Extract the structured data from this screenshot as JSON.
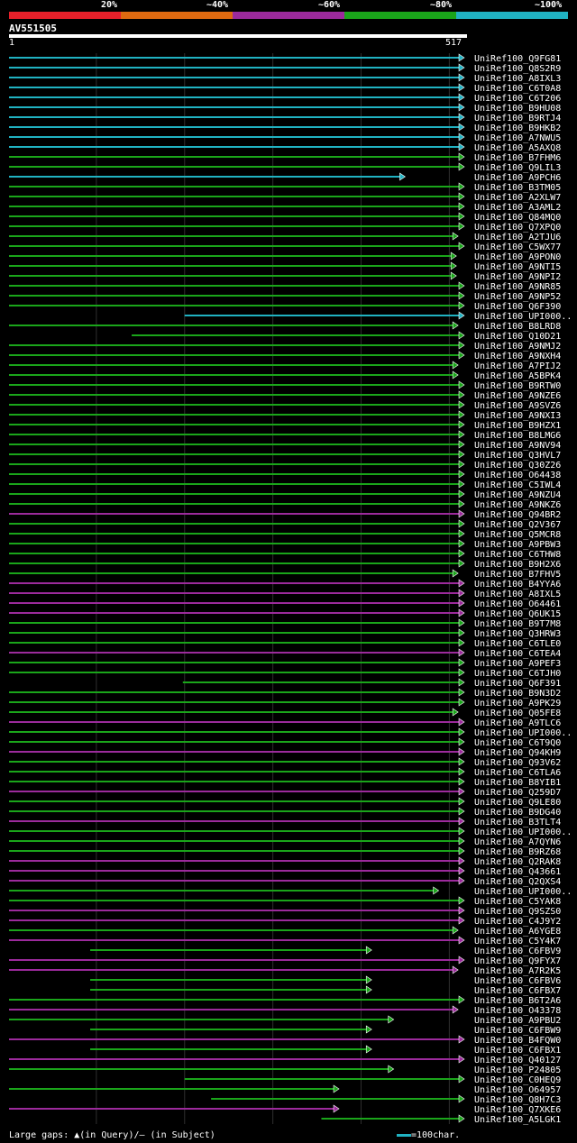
{
  "legend": {
    "labels": [
      "20%",
      "~40%",
      "~60%",
      "~80%",
      "~100%"
    ],
    "colors": [
      "#e8202a",
      "#e06a10",
      "#9c2a9c",
      "#1aa51a",
      "#20b2c2"
    ]
  },
  "query": {
    "name": "AV551505",
    "start": "1",
    "end": "517",
    "length": 517
  },
  "footer": {
    "text": "Large gaps: ▲(in Query)/– (in Subject)",
    "scale": "=100char."
  },
  "hits": [
    {
      "label": "UniRef100_Q9FG81",
      "s": 1,
      "e": 517,
      "c": 4
    },
    {
      "label": "UniRef100_Q8S2R9",
      "s": 1,
      "e": 517,
      "c": 4
    },
    {
      "label": "UniRef100_A8IXL3",
      "s": 1,
      "e": 517,
      "c": 4
    },
    {
      "label": "UniRef100_C6T0A8",
      "s": 1,
      "e": 517,
      "c": 4
    },
    {
      "label": "UniRef100_C6T206",
      "s": 1,
      "e": 517,
      "c": 4
    },
    {
      "label": "UniRef100_B9HU08",
      "s": 1,
      "e": 517,
      "c": 4
    },
    {
      "label": "UniRef100_B9RTJ4",
      "s": 1,
      "e": 517,
      "c": 4
    },
    {
      "label": "UniRef100_B9HKB2",
      "s": 1,
      "e": 517,
      "c": 4
    },
    {
      "label": "UniRef100_A7NWU5",
      "s": 1,
      "e": 517,
      "c": 4
    },
    {
      "label": "UniRef100_A5AXQ8",
      "s": 1,
      "e": 517,
      "c": 4
    },
    {
      "label": "UniRef100_B7FHM6",
      "s": 1,
      "e": 517,
      "c": 3
    },
    {
      "label": "UniRef100_Q9LIL3",
      "s": 1,
      "e": 517,
      "c": 3
    },
    {
      "label": "UniRef100_A9PCH6",
      "s": 1,
      "e": 450,
      "c": 4
    },
    {
      "label": "UniRef100_B3TM05",
      "s": 1,
      "e": 517,
      "c": 3
    },
    {
      "label": "UniRef100_A2XLW7",
      "s": 1,
      "e": 517,
      "c": 3
    },
    {
      "label": "UniRef100_A3AML2",
      "s": 1,
      "e": 517,
      "c": 3
    },
    {
      "label": "UniRef100_Q84MQ0",
      "s": 1,
      "e": 517,
      "c": 3
    },
    {
      "label": "UniRef100_Q7XPQ0",
      "s": 1,
      "e": 517,
      "c": 3
    },
    {
      "label": "UniRef100_A2TJU6",
      "s": 1,
      "e": 510,
      "c": 3
    },
    {
      "label": "UniRef100_C5WX77",
      "s": 1,
      "e": 517,
      "c": 3
    },
    {
      "label": "UniRef100_A9PON0",
      "s": 1,
      "e": 508,
      "c": 3
    },
    {
      "label": "UniRef100_A9NTI5",
      "s": 1,
      "e": 508,
      "c": 3
    },
    {
      "label": "UniRef100_A9NPI2",
      "s": 1,
      "e": 508,
      "c": 3
    },
    {
      "label": "UniRef100_A9NR85",
      "s": 1,
      "e": 517,
      "c": 3
    },
    {
      "label": "UniRef100_A9NP52",
      "s": 1,
      "e": 517,
      "c": 3
    },
    {
      "label": "UniRef100_Q6F390",
      "s": 1,
      "e": 517,
      "c": 3
    },
    {
      "label": "UniRef100_UPI000..",
      "s": 200,
      "e": 517,
      "c": 4
    },
    {
      "label": "UniRef100_B8LRD8",
      "s": 1,
      "e": 510,
      "c": 3
    },
    {
      "label": "UniRef100_Q10D21",
      "s": 140,
      "e": 517,
      "c": 3
    },
    {
      "label": "UniRef100_A9NMJ2",
      "s": 1,
      "e": 517,
      "c": 3
    },
    {
      "label": "UniRef100_A9NXH4",
      "s": 1,
      "e": 517,
      "c": 3
    },
    {
      "label": "UniRef100_A7PIJ2",
      "s": 1,
      "e": 510,
      "c": 3
    },
    {
      "label": "UniRef100_A5BPK4",
      "s": 1,
      "e": 510,
      "c": 3
    },
    {
      "label": "UniRef100_B9RTW0",
      "s": 1,
      "e": 517,
      "c": 3
    },
    {
      "label": "UniRef100_A9NZE6",
      "s": 1,
      "e": 517,
      "c": 3
    },
    {
      "label": "UniRef100_A9SVZ6",
      "s": 1,
      "e": 517,
      "c": 3
    },
    {
      "label": "UniRef100_A9NXI3",
      "s": 1,
      "e": 517,
      "c": 3
    },
    {
      "label": "UniRef100_B9HZX1",
      "s": 1,
      "e": 517,
      "c": 3
    },
    {
      "label": "UniRef100_B8LMG6",
      "s": 1,
      "e": 517,
      "c": 3
    },
    {
      "label": "UniRef100_A9NV94",
      "s": 1,
      "e": 517,
      "c": 3
    },
    {
      "label": "UniRef100_Q3HVL7",
      "s": 1,
      "e": 517,
      "c": 3
    },
    {
      "label": "UniRef100_Q30Z26",
      "s": 1,
      "e": 517,
      "c": 3
    },
    {
      "label": "UniRef100_O64438",
      "s": 1,
      "e": 517,
      "c": 3
    },
    {
      "label": "UniRef100_C5IWL4",
      "s": 1,
      "e": 517,
      "c": 3
    },
    {
      "label": "UniRef100_A9NZU4",
      "s": 1,
      "e": 517,
      "c": 3
    },
    {
      "label": "UniRef100_A9NKZ6",
      "s": 1,
      "e": 517,
      "c": 3
    },
    {
      "label": "UniRef100_Q94BR2",
      "s": 1,
      "e": 517,
      "c": 2
    },
    {
      "label": "UniRef100_Q2V367",
      "s": 1,
      "e": 517,
      "c": 3
    },
    {
      "label": "UniRef100_Q5MCR8",
      "s": 1,
      "e": 517,
      "c": 3
    },
    {
      "label": "UniRef100_A9PBW3",
      "s": 1,
      "e": 517,
      "c": 3
    },
    {
      "label": "UniRef100_C6THW8",
      "s": 1,
      "e": 517,
      "c": 3
    },
    {
      "label": "UniRef100_B9H2X6",
      "s": 1,
      "e": 517,
      "c": 3
    },
    {
      "label": "UniRef100_B7FHV5",
      "s": 1,
      "e": 510,
      "c": 3
    },
    {
      "label": "UniRef100_B4YYA6",
      "s": 1,
      "e": 517,
      "c": 2
    },
    {
      "label": "UniRef100_A8IXL5",
      "s": 1,
      "e": 517,
      "c": 2
    },
    {
      "label": "UniRef100_O64461",
      "s": 1,
      "e": 517,
      "c": 2
    },
    {
      "label": "UniRef100_Q6UK15",
      "s": 1,
      "e": 517,
      "c": 2
    },
    {
      "label": "UniRef100_B9T7M8",
      "s": 1,
      "e": 517,
      "c": 3
    },
    {
      "label": "UniRef100_Q3HRW3",
      "s": 1,
      "e": 517,
      "c": 3
    },
    {
      "label": "UniRef100_C6TLE0",
      "s": 1,
      "e": 517,
      "c": 3
    },
    {
      "label": "UniRef100_C6TEA4",
      "s": 1,
      "e": 517,
      "c": 2
    },
    {
      "label": "UniRef100_A9PEF3",
      "s": 1,
      "e": 517,
      "c": 3
    },
    {
      "label": "UniRef100_C6TJH0",
      "s": 1,
      "e": 517,
      "c": 3
    },
    {
      "label": "UniRef100_Q6F391",
      "s": 198,
      "e": 517,
      "c": 3
    },
    {
      "label": "UniRef100_B9N3D2",
      "s": 1,
      "e": 517,
      "c": 3
    },
    {
      "label": "UniRef100_A9PK29",
      "s": 1,
      "e": 517,
      "c": 3
    },
    {
      "label": "UniRef100_Q05FE8",
      "s": 1,
      "e": 510,
      "c": 3
    },
    {
      "label": "UniRef100_A9TLC6",
      "s": 1,
      "e": 517,
      "c": 2
    },
    {
      "label": "UniRef100_UPI000..",
      "s": 1,
      "e": 517,
      "c": 3
    },
    {
      "label": "UniRef100_C6T9Q0",
      "s": 1,
      "e": 517,
      "c": 3
    },
    {
      "label": "UniRef100_Q94KH9",
      "s": 1,
      "e": 517,
      "c": 2
    },
    {
      "label": "UniRef100_Q93V62",
      "s": 1,
      "e": 517,
      "c": 3
    },
    {
      "label": "UniRef100_C6TLA6",
      "s": 1,
      "e": 517,
      "c": 3
    },
    {
      "label": "UniRef100_B8YIB1",
      "s": 1,
      "e": 517,
      "c": 3
    },
    {
      "label": "UniRef100_Q259D7",
      "s": 1,
      "e": 517,
      "c": 2
    },
    {
      "label": "UniRef100_Q9LE80",
      "s": 1,
      "e": 517,
      "c": 3
    },
    {
      "label": "UniRef100_B9DG40",
      "s": 1,
      "e": 517,
      "c": 3
    },
    {
      "label": "UniRef100_B3TLT4",
      "s": 1,
      "e": 517,
      "c": 2
    },
    {
      "label": "UniRef100_UPI000..",
      "s": 1,
      "e": 517,
      "c": 3
    },
    {
      "label": "UniRef100_A7QYN6",
      "s": 1,
      "e": 517,
      "c": 3
    },
    {
      "label": "UniRef100_B9RZ68",
      "s": 1,
      "e": 517,
      "c": 3
    },
    {
      "label": "UniRef100_Q2RAK8",
      "s": 1,
      "e": 517,
      "c": 2
    },
    {
      "label": "UniRef100_Q43661",
      "s": 1,
      "e": 517,
      "c": 2
    },
    {
      "label": "UniRef100_Q2QXS4",
      "s": 1,
      "e": 517,
      "c": 2
    },
    {
      "label": "UniRef100_UPI000..",
      "s": 1,
      "e": 488,
      "c": 3
    },
    {
      "label": "UniRef100_C5YAK8",
      "s": 1,
      "e": 517,
      "c": 3
    },
    {
      "label": "UniRef100_Q9SZS0",
      "s": 1,
      "e": 517,
      "c": 2
    },
    {
      "label": "UniRef100_C4J9Y2",
      "s": 1,
      "e": 517,
      "c": 2
    },
    {
      "label": "UniRef100_A6YGE8",
      "s": 1,
      "e": 510,
      "c": 3
    },
    {
      "label": "UniRef100_C5Y4K7",
      "s": 1,
      "e": 517,
      "c": 2
    },
    {
      "label": "UniRef100_C6FBV9",
      "s": 93,
      "e": 412,
      "c": 3
    },
    {
      "label": "UniRef100_Q9FYX7",
      "s": 1,
      "e": 517,
      "c": 2
    },
    {
      "label": "UniRef100_A7R2K5",
      "s": 1,
      "e": 510,
      "c": 2
    },
    {
      "label": "UniRef100_C6FBV6",
      "s": 93,
      "e": 412,
      "c": 3
    },
    {
      "label": "UniRef100_C6FBX7",
      "s": 93,
      "e": 412,
      "c": 3
    },
    {
      "label": "UniRef100_B6T2A6",
      "s": 1,
      "e": 517,
      "c": 3
    },
    {
      "label": "UniRef100_O43378",
      "s": 1,
      "e": 510,
      "c": 2
    },
    {
      "label": "UniRef100_A9PBU2",
      "s": 1,
      "e": 437,
      "c": 3
    },
    {
      "label": "UniRef100_C6FBW9",
      "s": 93,
      "e": 412,
      "c": 3
    },
    {
      "label": "UniRef100_B4FQW0",
      "s": 1,
      "e": 517,
      "c": 2
    },
    {
      "label": "UniRef100_C6FBX1",
      "s": 93,
      "e": 412,
      "c": 3
    },
    {
      "label": "UniRef100_Q40127",
      "s": 1,
      "e": 517,
      "c": 2
    },
    {
      "label": "UniRef100_P24805",
      "s": 1,
      "e": 437,
      "c": 3
    },
    {
      "label": "UniRef100_C0HEQ9",
      "s": 200,
      "e": 517,
      "c": 3
    },
    {
      "label": "UniRef100_O64957",
      "s": 1,
      "e": 375,
      "c": 3
    },
    {
      "label": "UniRef100_Q8H7C3",
      "s": 230,
      "e": 517,
      "c": 3
    },
    {
      "label": "UniRef100_Q7XKE6",
      "s": 1,
      "e": 375,
      "c": 2
    },
    {
      "label": "UniRef100_A5LGK1",
      "s": 355,
      "e": 517,
      "c": 3
    }
  ]
}
